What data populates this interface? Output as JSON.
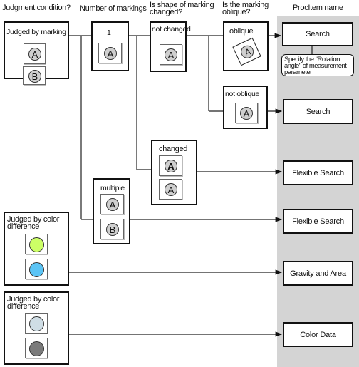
{
  "headers": {
    "judgment_condition": "Judgment condition?",
    "number_of_markings": "Number of markings",
    "shape_changed_line1": "Is shape of marking",
    "shape_changed_line2": "changed?",
    "oblique_line1": "Is the marking",
    "oblique_line2": "oblique?",
    "procitem_name": "ProcItem name"
  },
  "conditions": {
    "judged_by_marking": "Judged by marking",
    "color_diff_1_line1": "Judged by color",
    "color_diff_1_line2": "difference",
    "color_diff_2_line1": "Judged by color",
    "color_diff_2_line2": "difference"
  },
  "markings": {
    "one": "1",
    "multiple": "multiple",
    "not_changed": "not changed",
    "changed": "changed",
    "oblique": "oblique",
    "not_oblique": "not oblique",
    "letter_a": "A",
    "letter_b": "B"
  },
  "procitems": {
    "search_1": "Search",
    "search_2": "Search",
    "flexible_search_1": "Flexible Search",
    "flexible_search_2": "Flexible Search",
    "gravity_and_area": "Gravity and Area",
    "color_data": "Color Data"
  },
  "callout": {
    "line1": "Specify the \"Rotation",
    "line2": "angle\" of measurement",
    "line3": "parameter"
  },
  "colors": {
    "gray_column": "#d4d4d4",
    "marker_gray": "#cfcfcf",
    "yellow_green": "#ccff66",
    "sky_blue": "#5bc4f5",
    "pale_blue": "#cfdde5",
    "dark_gray": "#7a7a7a"
  }
}
